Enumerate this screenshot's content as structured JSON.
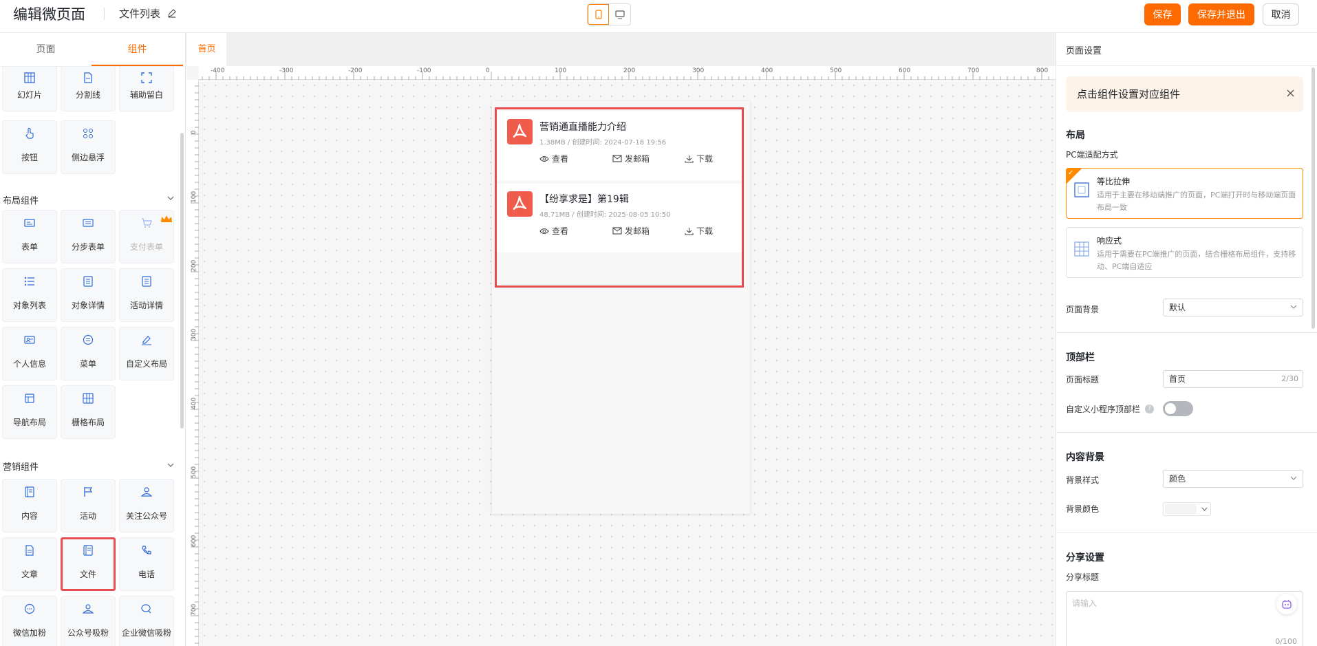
{
  "header": {
    "title": "编辑微页面",
    "subtitle": "文件列表",
    "save": "保存",
    "save_exit": "保存并退出",
    "cancel": "取消"
  },
  "left_panel": {
    "tabs": [
      "页面",
      "组件"
    ],
    "basic_items": [
      {
        "label": "幻灯片",
        "icon": "slides-icon"
      },
      {
        "label": "分割线",
        "icon": "divider-icon"
      },
      {
        "label": "辅助留白",
        "icon": "whitespace-icon"
      },
      {
        "label": "按钮",
        "icon": "button-icon"
      },
      {
        "label": "侧边悬浮",
        "icon": "float-icon"
      }
    ],
    "layout_section": "布局组件",
    "layout_items": [
      {
        "label": "表单",
        "icon": "form-icon"
      },
      {
        "label": "分步表单",
        "icon": "step-form-icon"
      },
      {
        "label": "支付表单",
        "icon": "payment-form-icon"
      },
      {
        "label": "对象列表",
        "icon": "object-list-icon"
      },
      {
        "label": "对象详情",
        "icon": "object-detail-icon"
      },
      {
        "label": "活动详情",
        "icon": "event-detail-icon"
      },
      {
        "label": "个人信息",
        "icon": "profile-icon"
      },
      {
        "label": "菜单",
        "icon": "menu-icon"
      },
      {
        "label": "自定义布局",
        "icon": "custom-layout-icon"
      },
      {
        "label": "导航布局",
        "icon": "nav-layout-icon"
      },
      {
        "label": "栅格布局",
        "icon": "grid-layout-icon"
      }
    ],
    "marketing_section": "营销组件",
    "marketing_items": [
      {
        "label": "内容",
        "icon": "content-icon"
      },
      {
        "label": "活动",
        "icon": "flag-icon"
      },
      {
        "label": "关注公众号",
        "icon": "follow-icon"
      },
      {
        "label": "文章",
        "icon": "article-icon"
      },
      {
        "label": "文件",
        "icon": "file-icon"
      },
      {
        "label": "电话",
        "icon": "phone-icon"
      },
      {
        "label": "微信加粉",
        "icon": "wechat-icon"
      },
      {
        "label": "公众号吸粉",
        "icon": "oa-fans-icon"
      },
      {
        "label": "企业微信吸粉",
        "icon": "wecom-icon"
      }
    ]
  },
  "canvas": {
    "tab": "首页",
    "ruler_x": [
      "-400",
      "-300",
      "-200",
      "-100",
      "0",
      "100",
      "200",
      "300",
      "400",
      "500",
      "600",
      "700",
      "800"
    ],
    "ruler_y": [
      "0",
      "100",
      "200",
      "300",
      "400",
      "500",
      "600",
      "700"
    ],
    "files": [
      {
        "name": "营销通直播能力介绍",
        "meta": "1.38MB / 创建时间:  2024-07-18 19:56"
      },
      {
        "name": "【纷享求是】第19辑",
        "meta": "48.71MB / 创建时间:  2025-08-05 10:50"
      }
    ],
    "actions": {
      "view": "查看",
      "mail": "发邮箱",
      "download": "下载"
    }
  },
  "right_panel": {
    "title": "页面设置",
    "notice": "点击组件设置对应组件",
    "layout": "布局",
    "pc_adapt": "PC端适配方式",
    "opt1_title": "等比拉伸",
    "opt1_desc": "适用于主要在移动端推广的页面，PC端打开时与移动端页面布局一致",
    "opt2_title": "响应式",
    "opt2_desc": "适用于需要在PC端推广的页面，结合栅格布局组件，支持移动、PC端自适应",
    "page_bg_label": "页面背景",
    "page_bg_value": "默认",
    "topbar": "顶部栏",
    "page_title_label": "页面标题",
    "page_title_value": "首页",
    "page_title_count": "2/30",
    "custom_topbar_label": "自定义小程序顶部栏",
    "content_bg": "内容背景",
    "bg_style_label": "背景样式",
    "bg_style_value": "颜色",
    "bg_color_label": "背景颜色",
    "share": "分享设置",
    "share_title_label": "分享标题",
    "share_placeholder": "请输入",
    "share_count": "0/100"
  },
  "colors": {
    "accent": "#ff6a00",
    "highlight": "#e84b4b",
    "pdf": "#ef5c4c"
  }
}
